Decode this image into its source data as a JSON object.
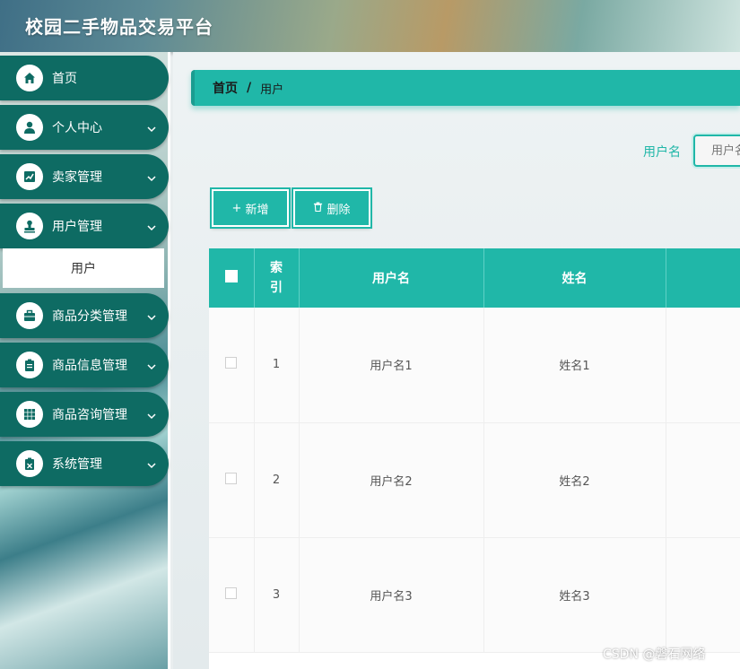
{
  "app": {
    "title": "校园二手物品交易平台"
  },
  "sidebar": {
    "items": [
      {
        "label": "首页",
        "icon": "home-icon",
        "has_arrow": false
      },
      {
        "label": "个人中心",
        "icon": "user-icon",
        "has_arrow": true
      },
      {
        "label": "卖家管理",
        "icon": "chart-icon",
        "has_arrow": true
      },
      {
        "label": "用户管理",
        "icon": "stamp-icon",
        "has_arrow": true
      },
      {
        "label": "商品分类管理",
        "icon": "briefcase-icon",
        "has_arrow": true
      },
      {
        "label": "商品信息管理",
        "icon": "clipboard-icon",
        "has_arrow": true
      },
      {
        "label": "商品咨询管理",
        "icon": "grid-icon",
        "has_arrow": true
      },
      {
        "label": "系统管理",
        "icon": "settings-clipboard-icon",
        "has_arrow": true
      }
    ],
    "sub_item": {
      "label": "用户"
    }
  },
  "breadcrumb": {
    "home": "首页",
    "separator": "/",
    "current": "用户"
  },
  "search": {
    "label": "用户名",
    "placeholder": "用户名"
  },
  "toolbar": {
    "add_label": "新增",
    "delete_label": "删除"
  },
  "table": {
    "headers": [
      "",
      "索引",
      "用户名",
      "姓名",
      ""
    ],
    "rows": [
      {
        "index": "1",
        "username": "用户名1",
        "name": "姓名1"
      },
      {
        "index": "2",
        "username": "用户名2",
        "name": "姓名2"
      },
      {
        "index": "3",
        "username": "用户名3",
        "name": "姓名3"
      }
    ]
  },
  "watermark": "CSDN @磐石网络",
  "colors": {
    "accent": "#20b7a8",
    "sidebar": "#0e6b63"
  }
}
